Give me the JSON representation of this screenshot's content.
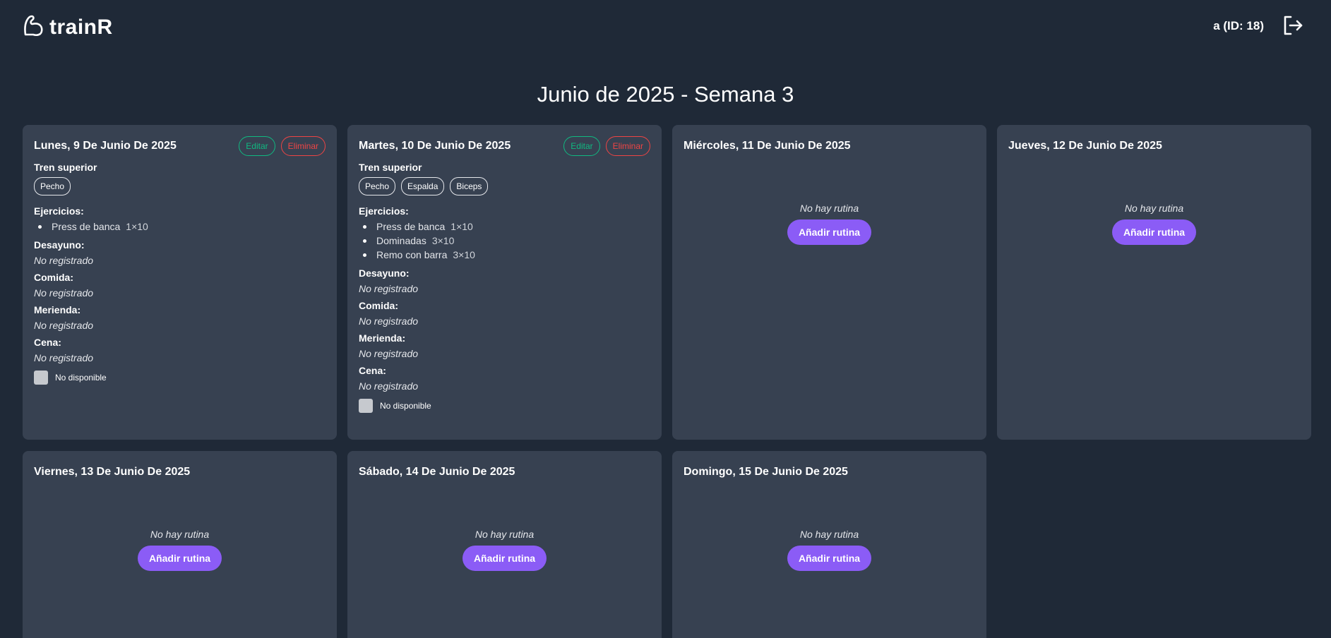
{
  "app": {
    "name": "trainR"
  },
  "user": {
    "label": "a (ID: 18)"
  },
  "page": {
    "title": "Junio de 2025 - Semana 3"
  },
  "labels": {
    "edit": "Editar",
    "delete": "Eliminar",
    "exercises": "Ejercicios:",
    "breakfast": "Desayuno:",
    "lunch": "Comida:",
    "snack": "Merienda:",
    "dinner": "Cena:",
    "not_registered": "No registrado",
    "unavailable": "No disponible",
    "no_routine": "No hay rutina",
    "add_routine": "Añadir rutina"
  },
  "days": [
    {
      "title": "Lunes, 9 De Junio De 2025",
      "routine": "Tren superior",
      "tags": [
        "Pecho"
      ],
      "exercises": [
        {
          "name": "Press de banca",
          "sets": "1×10"
        }
      ]
    },
    {
      "title": "Martes, 10 De Junio De 2025",
      "routine": "Tren superior",
      "tags": [
        "Pecho",
        "Espalda",
        "Biceps"
      ],
      "exercises": [
        {
          "name": "Press de banca",
          "sets": "1×10"
        },
        {
          "name": "Dominadas",
          "sets": "3×10"
        },
        {
          "name": "Remo con barra",
          "sets": "3×10"
        }
      ]
    },
    {
      "title": "Miércoles, 11 De Junio De 2025"
    },
    {
      "title": "Jueves, 12 De Junio De 2025"
    },
    {
      "title": "Viernes, 13 De Junio De 2025"
    },
    {
      "title": "Sábado, 14 De Junio De 2025"
    },
    {
      "title": "Domingo, 15 De Junio De 2025"
    }
  ],
  "colors": {
    "background": "#1f2937",
    "card": "#374151",
    "accent": "#8b5cf6",
    "edit": "#10b981",
    "delete": "#ef4444"
  }
}
